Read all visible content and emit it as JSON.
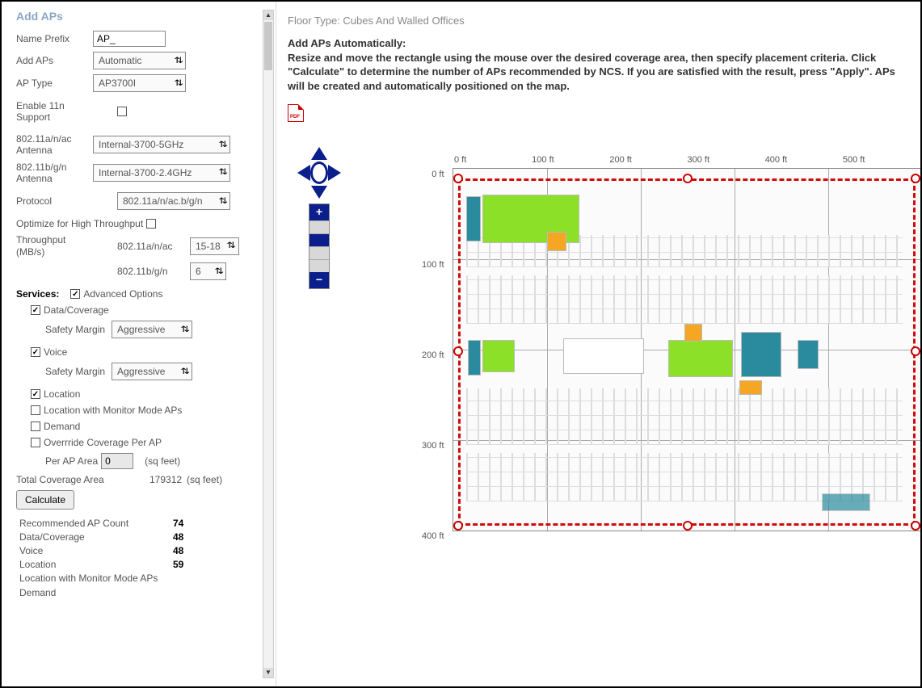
{
  "title": "Add APs",
  "form": {
    "name_prefix_label": "Name Prefix",
    "name_prefix_value": "AP_",
    "add_aps_label": "Add APs",
    "add_aps_value": "Automatic",
    "ap_type_label": "AP Type",
    "ap_type_value": "AP3700I",
    "enable_11n_label": "Enable 11n Support",
    "antenna_a_label": "802.11a/n/ac Antenna",
    "antenna_a_value": "Internal-3700-5GHz",
    "antenna_b_label": "802.11b/g/n Antenna",
    "antenna_b_value": "Internal-3700-2.4GHz",
    "protocol_label": "Protocol",
    "protocol_value": "802.11a/n/ac.b/g/n",
    "optimize_label": "Optimize for High Throughput",
    "throughput_label": "Throughput (MB/s)",
    "throughput_a_label": "802.11a/n/ac",
    "throughput_a_value": "15-18",
    "throughput_b_label": "802.11b/g/n",
    "throughput_b_value": "6"
  },
  "services": {
    "heading": "Services:",
    "advanced_label": "Advanced Options",
    "data_coverage": "Data/Coverage",
    "safety_margin": "Safety Margin",
    "safety_value": "Aggressive",
    "voice": "Voice",
    "location": "Location",
    "location_monitor": "Location with Monitor Mode APs",
    "demand": "Demand",
    "override": "Overrride Coverage Per AP",
    "per_ap_area_label": "Per AP Area",
    "per_ap_area_value": "0",
    "per_ap_unit": "(sq feet)",
    "total_cov_label": "Total Coverage Area",
    "total_cov_value": "179312",
    "total_cov_unit": "(sq feet)",
    "calculate_btn": "Calculate"
  },
  "results": {
    "recommended_label": "Recommended AP Count",
    "recommended_val": "74",
    "data_label": "Data/Coverage",
    "data_val": "48",
    "voice_label": "Voice",
    "voice_val": "48",
    "location_label": "Location",
    "location_val": "59",
    "location_monitor_label": "Location with Monitor Mode APs",
    "demand_label": "Demand"
  },
  "main": {
    "floor_type_label": "Floor Type:",
    "floor_type_value": "Cubes And Walled Offices",
    "instr_title": "Add APs Automatically:",
    "instr_body": "Resize and move the rectangle using the mouse over the desired coverage area, then specify placement criteria. Click \"Calculate\" to determine the number of APs recommended by NCS. If  you are satisfied with the result, press \"Apply\". APs will be created and automatically positioned on the map."
  },
  "axes": {
    "x": [
      "0 ft",
      "100 ft",
      "200 ft",
      "300 ft",
      "400 ft",
      "500 ft"
    ],
    "y": [
      "0 ft",
      "100 ft",
      "200 ft",
      "300 ft",
      "400 ft"
    ]
  },
  "icons": {
    "pdf": "pdf-icon"
  }
}
